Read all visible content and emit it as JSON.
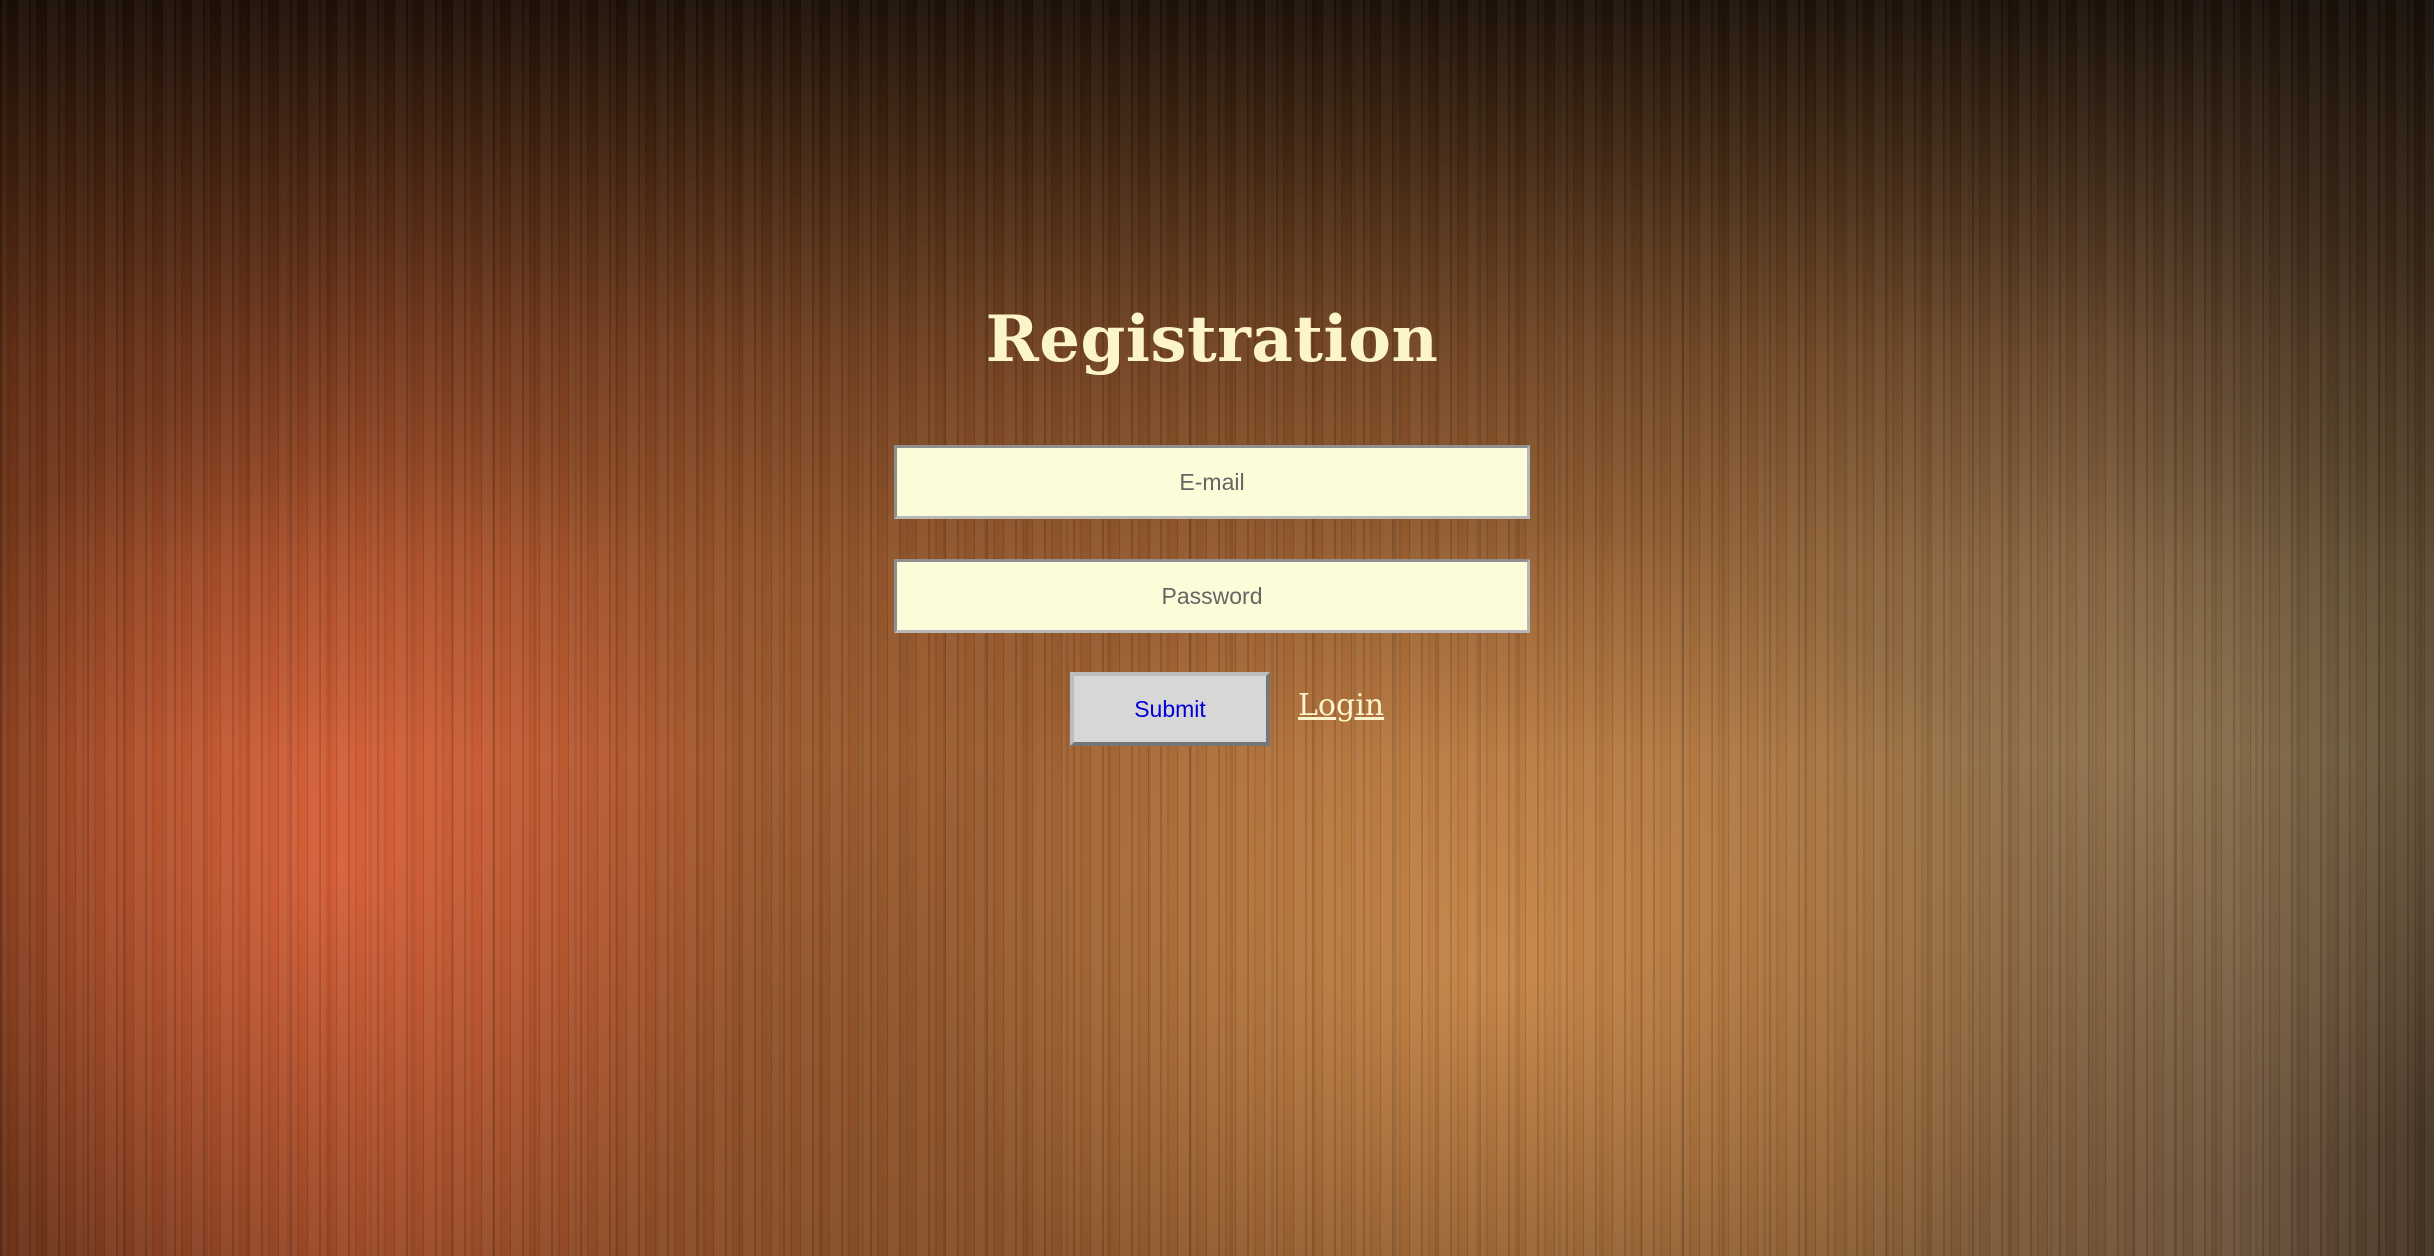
{
  "page": {
    "title": "Registration"
  },
  "form": {
    "email": {
      "value": "",
      "placeholder": "E-mail"
    },
    "password": {
      "value": "",
      "placeholder": "Password"
    },
    "submit_label": "Submit",
    "login_link_label": "Login"
  },
  "colors": {
    "title_text": "#fbf5c9",
    "input_background": "#fcfcd8",
    "button_background": "#d7d7d7",
    "button_text": "#0000d8",
    "link_text": "#fbf5c9"
  }
}
